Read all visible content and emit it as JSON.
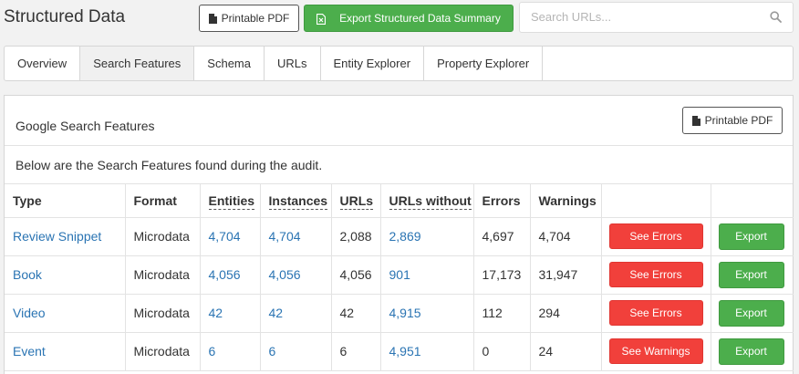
{
  "header": {
    "title": "Structured Data",
    "pdf_label": "Printable PDF",
    "export_label": "Export Structured Data Summary",
    "search_placeholder": "Search URLs..."
  },
  "tabs": [
    {
      "label": "Overview",
      "active": false
    },
    {
      "label": "Search Features",
      "active": true
    },
    {
      "label": "Schema",
      "active": false
    },
    {
      "label": "URLs",
      "active": false
    },
    {
      "label": "Entity Explorer",
      "active": false
    },
    {
      "label": "Property Explorer",
      "active": false
    }
  ],
  "panel": {
    "title": "Google Search Features",
    "pdf_label": "Printable PDF",
    "description": "Below are the Search Features found during the audit."
  },
  "table": {
    "columns": [
      "Type",
      "Format",
      "Entities",
      "Instances",
      "URLs",
      "URLs without",
      "Errors",
      "Warnings"
    ],
    "rows": [
      {
        "type": "Review Snippet",
        "format": "Microdata",
        "entities": "4,704",
        "instances": "4,704",
        "urls": "2,088",
        "urls_without": "2,869",
        "errors": "4,697",
        "warnings": "4,704",
        "action": "See Errors",
        "export": "Export"
      },
      {
        "type": "Book",
        "format": "Microdata",
        "entities": "4,056",
        "instances": "4,056",
        "urls": "4,056",
        "urls_without": "901",
        "errors": "17,173",
        "warnings": "31,947",
        "action": "See Errors",
        "export": "Export"
      },
      {
        "type": "Video",
        "format": "Microdata",
        "entities": "42",
        "instances": "42",
        "urls": "42",
        "urls_without": "4,915",
        "errors": "112",
        "warnings": "294",
        "action": "See Errors",
        "export": "Export"
      },
      {
        "type": "Event",
        "format": "Microdata",
        "entities": "6",
        "instances": "6",
        "urls": "6",
        "urls_without": "4,951",
        "errors": "0",
        "warnings": "24",
        "action": "See Warnings",
        "export": "Export"
      }
    ]
  },
  "colors": {
    "link": "#2a74b3",
    "green": "#4cae4c",
    "red": "#f1403b"
  },
  "icons": [
    "document-icon",
    "export-file-icon",
    "search-icon"
  ]
}
